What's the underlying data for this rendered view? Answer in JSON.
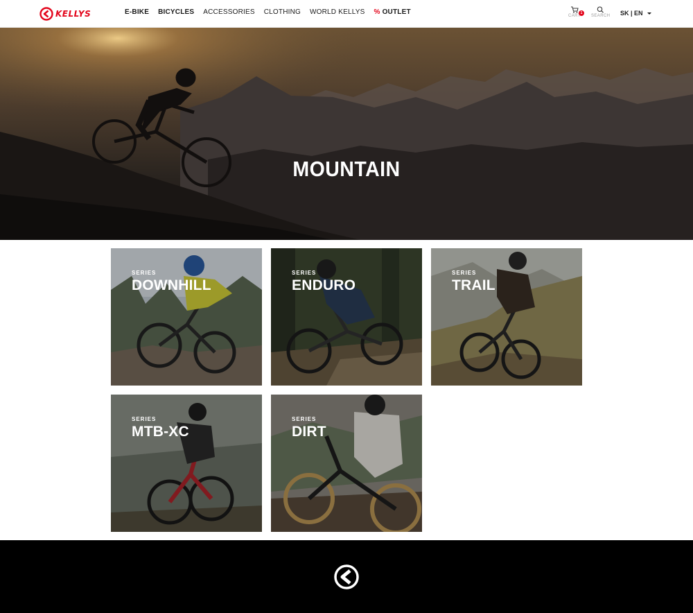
{
  "header": {
    "brand": "KELLYS",
    "nav": [
      {
        "label": "E-BIKE"
      },
      {
        "label": "BICYCLES"
      },
      {
        "label": "ACCESSORIES"
      },
      {
        "label": "CLOTHING"
      },
      {
        "label": "WORLD KELLYS"
      },
      {
        "prefix": "%",
        "label": "OUTLET"
      }
    ],
    "cart": {
      "label": "CART",
      "count": "1"
    },
    "search": {
      "label": "SEARCH"
    },
    "lang": "SK | EN"
  },
  "hero": {
    "title": "MOUNTAIN"
  },
  "series_label": "SERIES",
  "cards": [
    {
      "title": "DOWNHILL"
    },
    {
      "title": "ENDURO"
    },
    {
      "title": "TRAIL"
    },
    {
      "title": "MTB-XC"
    },
    {
      "title": "DIRT"
    }
  ],
  "colors": {
    "brand_red": "#e3051b",
    "footer": "#000000"
  }
}
